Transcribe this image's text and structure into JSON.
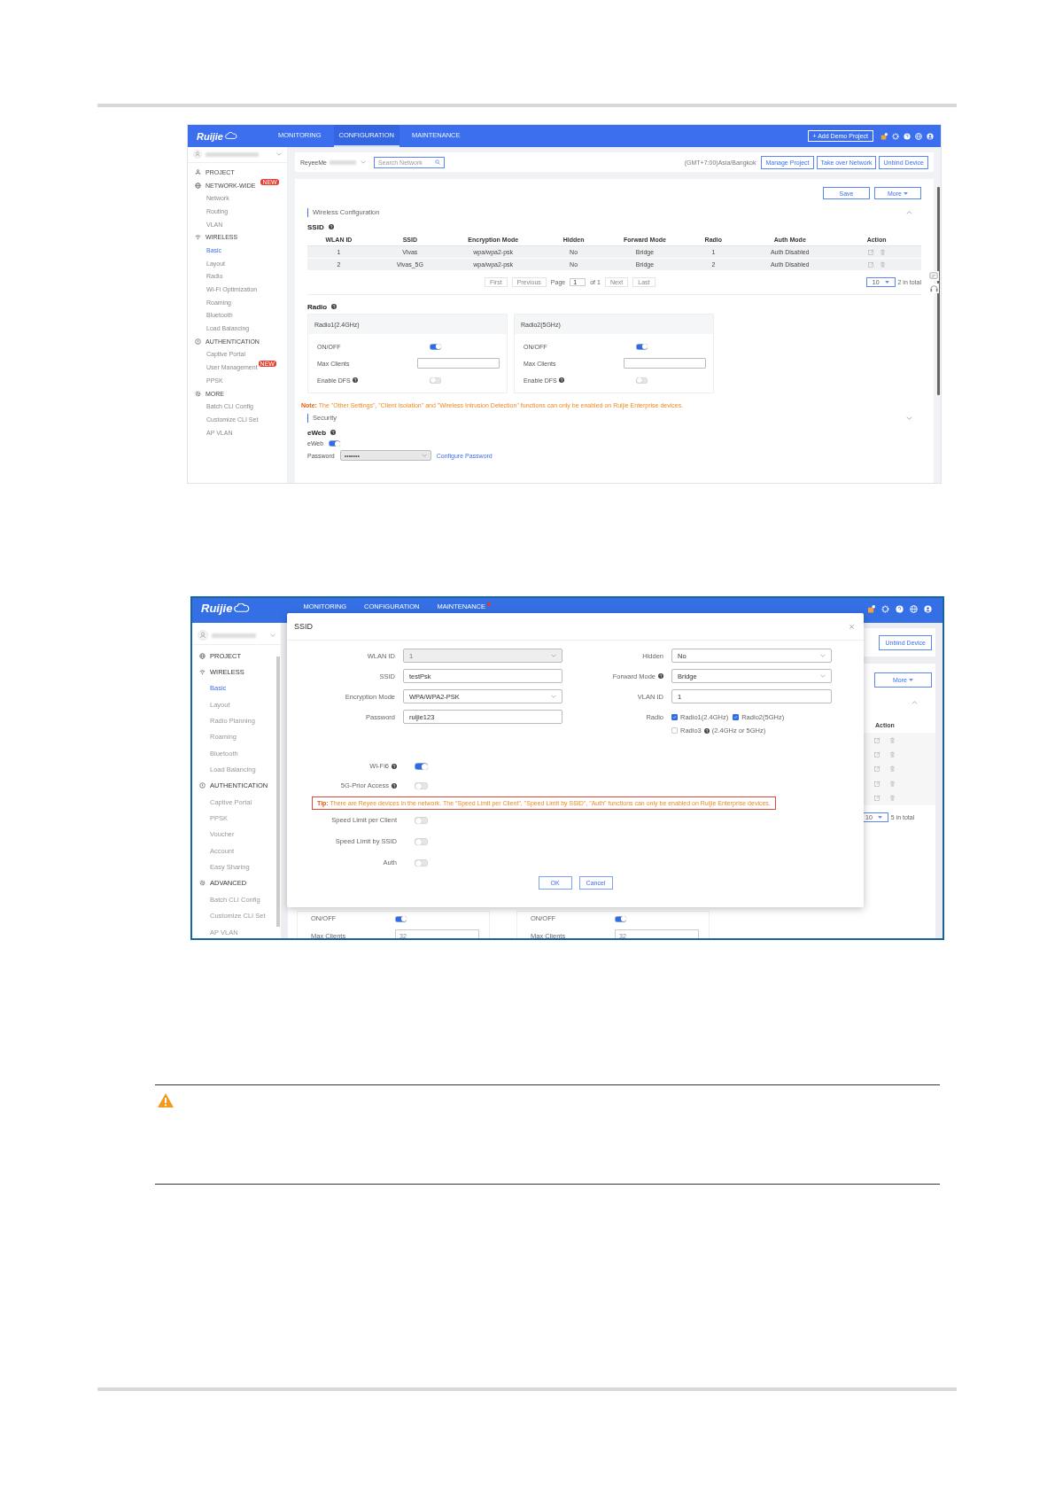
{
  "config_page": {
    "navbar": {
      "brand": "Ruijie",
      "tabs": [
        {
          "label": "MONITORING",
          "selected": false
        },
        {
          "label": "CONFIGURATION",
          "selected": true
        },
        {
          "label": "MAINTENANCE",
          "selected": false
        }
      ],
      "add_project_button": "+ Add Demo Project"
    },
    "sidebar": {
      "sections": [
        {
          "label": "PROJECT"
        },
        {
          "label": "NETWORK-WIDE",
          "badge": "NEW",
          "items": [
            {
              "label": "Network",
              "selected": false
            },
            {
              "label": "Routing",
              "selected": false
            },
            {
              "label": "VLAN",
              "selected": false
            }
          ]
        },
        {
          "label": "WIRELESS",
          "items": [
            {
              "label": "Basic",
              "selected": true
            },
            {
              "label": "Layout",
              "selected": false
            },
            {
              "label": "Radio",
              "selected": false
            },
            {
              "label": "Wi-Fi Optimization",
              "selected": false
            },
            {
              "label": "Roaming",
              "selected": false
            },
            {
              "label": "Bluetooth",
              "selected": false
            },
            {
              "label": "Load Balancing",
              "selected": false
            }
          ]
        },
        {
          "label": "AUTHENTICATION",
          "items": [
            {
              "label": "Captive Portal",
              "selected": false
            },
            {
              "label": "User Management",
              "badge": "NEW",
              "selected": false
            },
            {
              "label": "PPSK",
              "selected": false
            }
          ]
        },
        {
          "label": "MORE",
          "items": [
            {
              "label": "Batch CLI Config",
              "selected": false
            },
            {
              "label": "Customize CLI Set",
              "selected": false
            },
            {
              "label": "AP VLAN",
              "selected": false
            }
          ]
        }
      ]
    },
    "toolbar": {
      "network": "ReyeeMe",
      "search_placeholder": "Search Network",
      "timezone": "(GMT+7:00)Asia/Bangkok",
      "buttons": [
        "Manage Project",
        "Take over Network",
        "Unbind Device"
      ]
    },
    "page_buttons": [
      "Save",
      "More"
    ],
    "wireless_section": {
      "title": "Wireless Configuration",
      "ssid_heading": "SSID",
      "table": {
        "columns": [
          "WLAN ID",
          "SSID",
          "Encryption Mode",
          "Hidden",
          "Forward Mode",
          "Radio",
          "Auth Mode",
          "Action"
        ],
        "rows": [
          [
            "1",
            "Vivas",
            "wpa/wpa2-psk",
            "No",
            "Bridge",
            "1",
            "Auth Disabled"
          ],
          [
            "2",
            "Vivas_5G",
            "wpa/wpa2-psk",
            "No",
            "Bridge",
            "2",
            "Auth Disabled"
          ]
        ]
      },
      "pagination": {
        "first": "First",
        "previous": "Previous",
        "page_label": "Page",
        "page": "1",
        "page_count": "of 1",
        "next": "Next",
        "last": "Last",
        "page_size": "10",
        "total": "2 in total"
      }
    },
    "radio_heading": "Radio",
    "radio_cards": [
      {
        "title": "Radio1(2.4GHz)",
        "on_off_label": "ON/OFF",
        "on": true,
        "max_clients_label": "Max Clients",
        "dfs_label": "Enable DFS",
        "dfs": false
      },
      {
        "title": "Radio2(5GHz)",
        "on_off_label": "ON/OFF",
        "on": true,
        "max_clients_label": "Max Clients",
        "dfs_label": "Enable DFS",
        "dfs": false
      }
    ],
    "note": "**Note:** The \"Other Settings\", \"Client Isolation\" and \"Wireless Intrusion Detection\" functions can only be enabled on Ruijie Enterprise devices.",
    "security_section": {
      "title": "Security",
      "eweb_heading": "eWeb",
      "eweb_label": "eWeb",
      "eweb_on": true,
      "password_label": "Password",
      "password_value": "•••••••",
      "configure_link": "Configure Password"
    }
  },
  "edit_page": {
    "navbar": {
      "brand": "Ruijie",
      "tabs": [
        {
          "label": "MONITORING",
          "selected": false,
          "alert": false
        },
        {
          "label": "CONFIGURATION",
          "selected": false,
          "alert": false
        },
        {
          "label": "MAINTENANCE",
          "selected": false,
          "alert": true
        }
      ]
    },
    "sidebar": {
      "sections": [
        {
          "label": "PROJECT"
        },
        {
          "label": "WIRELESS",
          "items": [
            {
              "label": "Basic",
              "selected": true
            },
            {
              "label": "Layout",
              "selected": false
            },
            {
              "label": "Radio Planning",
              "selected": false
            },
            {
              "label": "Roaming",
              "selected": false
            },
            {
              "label": "Bluetooth",
              "selected": false
            },
            {
              "label": "Load Balancing",
              "selected": false
            }
          ]
        },
        {
          "label": "AUTHENTICATION",
          "items": [
            {
              "label": "Captive Portal",
              "selected": false
            },
            {
              "label": "PPSK",
              "selected": false
            },
            {
              "label": "Voucher",
              "selected": false
            },
            {
              "label": "Account",
              "selected": false
            },
            {
              "label": "Easy Sharing",
              "selected": false
            }
          ]
        },
        {
          "label": "ADVANCED",
          "items": [
            {
              "label": "Batch CLI Config",
              "selected": false
            },
            {
              "label": "Customize CLI Set",
              "selected": false
            },
            {
              "label": "AP VLAN",
              "selected": false
            }
          ]
        }
      ]
    },
    "background": {
      "unbind_button": "Unbind Device",
      "more_button": "More",
      "action_header": "Action",
      "page_size": "10",
      "total": "5 in total",
      "radio_cards": [
        {
          "on_off_label": "ON/OFF",
          "on": true,
          "max_clients_label": "Max Clients",
          "max_clients": "32"
        },
        {
          "on_off_label": "ON/OFF",
          "on": true,
          "max_clients_label": "Max Clients",
          "max_clients": "32"
        }
      ]
    },
    "dialog": {
      "title": "SSID",
      "left_fields": [
        {
          "label": "WLAN ID",
          "kind": "select",
          "value": "1",
          "disabled": true,
          "help": false
        },
        {
          "label": "SSID",
          "kind": "input",
          "value": "testPsk",
          "disabled": false,
          "help": false
        },
        {
          "label": "Encryption Mode",
          "kind": "select",
          "value": "WPA/WPA2-PSK",
          "disabled": false,
          "help": false
        },
        {
          "label": "Password",
          "kind": "input",
          "value": "ruijie123",
          "disabled": false,
          "help": false
        }
      ],
      "right_fields": [
        {
          "label": "Hidden",
          "kind": "select",
          "value": "No",
          "disabled": false,
          "help": false
        },
        {
          "label": "Forward Mode",
          "kind": "select",
          "value": "Bridge",
          "disabled": false,
          "help": true
        },
        {
          "label": "VLAN ID",
          "kind": "input",
          "value": "1",
          "disabled": false,
          "help": false
        }
      ],
      "radio": {
        "label": "Radio",
        "options": [
          {
            "label": "Radio1(2.4GHz)",
            "checked": true,
            "help": false
          },
          {
            "label": "Radio2(5GHz)",
            "checked": true,
            "help": false
          },
          {
            "label": "Radio3",
            "checked": false,
            "help": true,
            "note": "(2.4GHz or 5GHz)"
          }
        ]
      },
      "toggles_top": [
        {
          "label": "Wi-Fi6",
          "help": true,
          "on": true
        },
        {
          "label": "5G-Prior Access",
          "help": true,
          "on": false
        }
      ],
      "tip": "**Tip:** There are Reyee devices in the network. The \"Speed Limit per Client\", \"Speed Limit by SSID\", \"Auth\" functions can only be enabled on Ruijie Enterprise devices.",
      "toggles_bottom": [
        {
          "label": "Speed Limit per Client",
          "help": false,
          "on": false
        },
        {
          "label": "Speed Limit by SSID",
          "help": false,
          "on": false
        },
        {
          "label": "Auth",
          "help": false,
          "on": false
        }
      ],
      "buttons": [
        "OK",
        "Cancel"
      ]
    }
  }
}
